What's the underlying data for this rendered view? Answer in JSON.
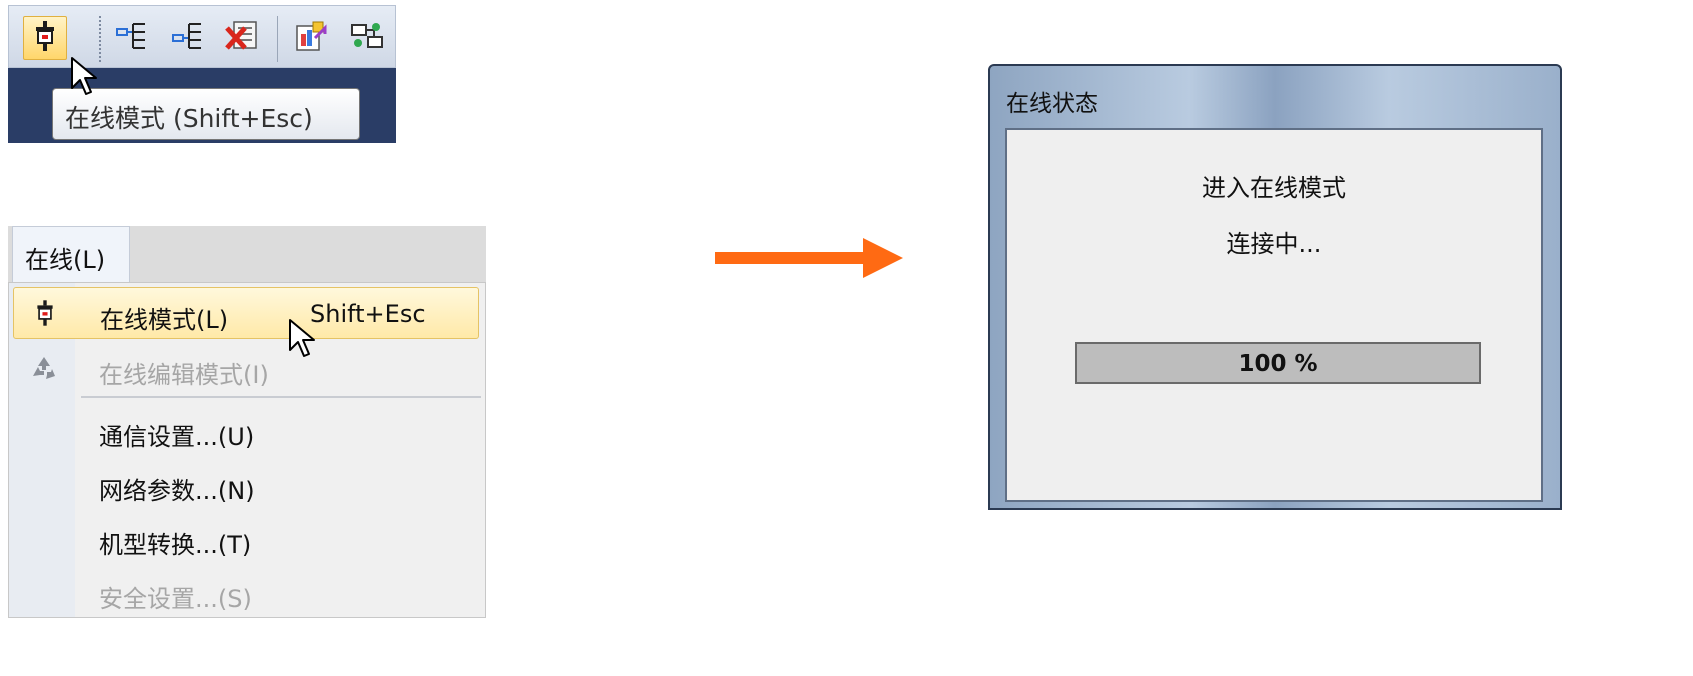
{
  "toolbar": {
    "buttons": [
      {
        "icon": "plug-icon",
        "state": "active"
      },
      {
        "icon": "tree-expand-icon"
      },
      {
        "icon": "tree-collapse-icon"
      },
      {
        "icon": "delete-icon"
      },
      {
        "icon": "chart-icon"
      },
      {
        "icon": "network-icon"
      }
    ],
    "tooltip": "在线模式 (Shift+Esc)"
  },
  "menu": {
    "title": "在线(L)",
    "items": [
      {
        "label": "在线模式(L)",
        "shortcut": "Shift+Esc",
        "icon": "plug-icon",
        "enabled": true,
        "highlighted": true
      },
      {
        "label": "在线编辑模式(I)",
        "icon": "recycle-icon",
        "enabled": false
      },
      {
        "label": "通信设置...(U)",
        "enabled": true
      },
      {
        "label": "网络参数...(N)",
        "enabled": true
      },
      {
        "label": "机型转换...(T)",
        "enabled": true
      },
      {
        "label": "安全设置...(S)",
        "enabled": false
      }
    ]
  },
  "dialog": {
    "title": "在线状态",
    "line1": "进入在线模式",
    "line2": "连接中...",
    "progress": {
      "value": 1.0,
      "label": "100 %"
    }
  },
  "colors": {
    "arrow": "#ff6a13",
    "toolbar_active": "#ffd66b",
    "menu_highlight": "#ffe9a8",
    "tooltip_band": "#2a3d66",
    "progress_fill": "#bdbdbd"
  }
}
